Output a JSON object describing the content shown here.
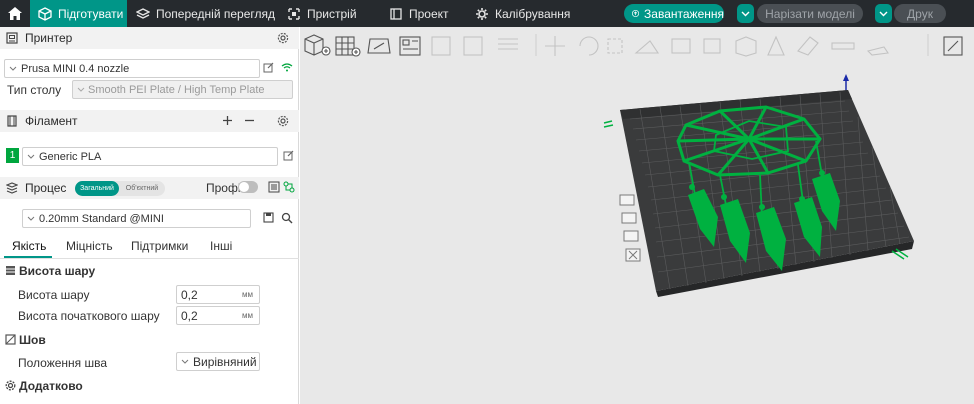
{
  "topbar": {
    "tabs": [
      {
        "label": "Підготувати",
        "icon": "cube-icon"
      },
      {
        "label": "Попередній перегляд",
        "icon": "layers-icon"
      },
      {
        "label": "Пристрій",
        "icon": "device-icon"
      },
      {
        "label": "Проект",
        "icon": "project-icon"
      },
      {
        "label": "Калібрування",
        "icon": "calibration-icon"
      }
    ],
    "upload_label": "Завантаження",
    "slice_label": "Нарізати моделі",
    "print_label": "Друк"
  },
  "printer": {
    "section_title": "Принтер",
    "selected": "Prusa MINI 0.4 nozzle",
    "bed_label": "Тип столу",
    "bed_value": "Smooth PEI Plate / High Temp Plate"
  },
  "filament": {
    "section_title": "Філамент",
    "slot": "1",
    "selected": "Generic PLA",
    "slot_color": "#00a63e"
  },
  "process": {
    "section_title": "Процес",
    "toggle_left": "Загальний",
    "toggle_right": "Об'єктний",
    "pro_label": "Профі",
    "preset": "0.20mm Standard @MINI",
    "tabs": [
      "Якість",
      "Міцність",
      "Підтримки",
      "Інші"
    ]
  },
  "groups": {
    "layer_height_title": "Висота шару",
    "layer_height_label": "Висота шару",
    "layer_height_value": "0,2",
    "layer_height_unit": "мм",
    "first_layer_label": "Висота початкового шару",
    "first_layer_value": "0,2",
    "first_layer_unit": "мм",
    "seam_title": "Шов",
    "seam_label": "Положення шва",
    "seam_value": "Вирівняний",
    "extra_title": "Додатково"
  },
  "colors": {
    "accent": "#009688",
    "model": "#00b140",
    "plate": "#3a3a3a"
  }
}
